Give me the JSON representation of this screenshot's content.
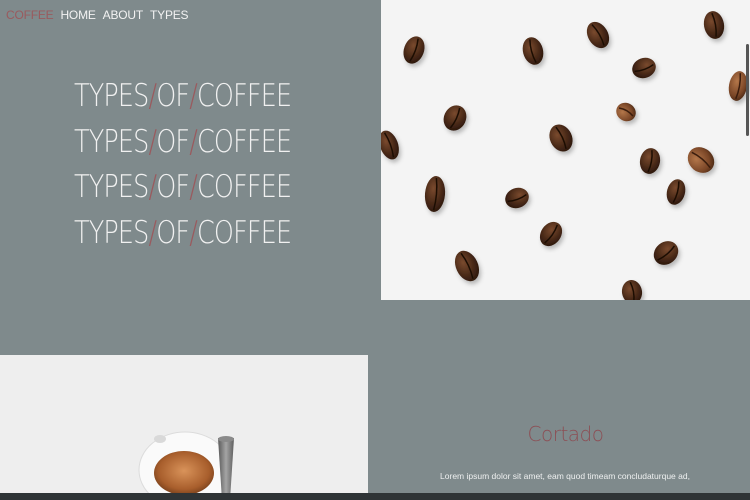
{
  "nav": {
    "brand": "COFFEE",
    "links": [
      "HOME",
      "ABOUT",
      "TYPES"
    ]
  },
  "hero": {
    "lines": [
      [
        "TYPES",
        "/",
        "OF",
        "/",
        "COFFEE"
      ],
      [
        "TYPES",
        "/",
        "OF",
        "/",
        "COFFEE"
      ],
      [
        "TYPES",
        "/",
        "OF",
        "/",
        "COFFEE"
      ],
      [
        "TYPES",
        "/",
        "OF",
        "/",
        "COFFEE"
      ]
    ]
  },
  "section": {
    "title": "Cortado",
    "body": "Lorem ipsum dolor sit amet, eam quod timeam concludaturque ad,"
  },
  "colors": {
    "background": "#7f8a8c",
    "accent": "#9a5a5e",
    "text": "#f1f1f1"
  }
}
